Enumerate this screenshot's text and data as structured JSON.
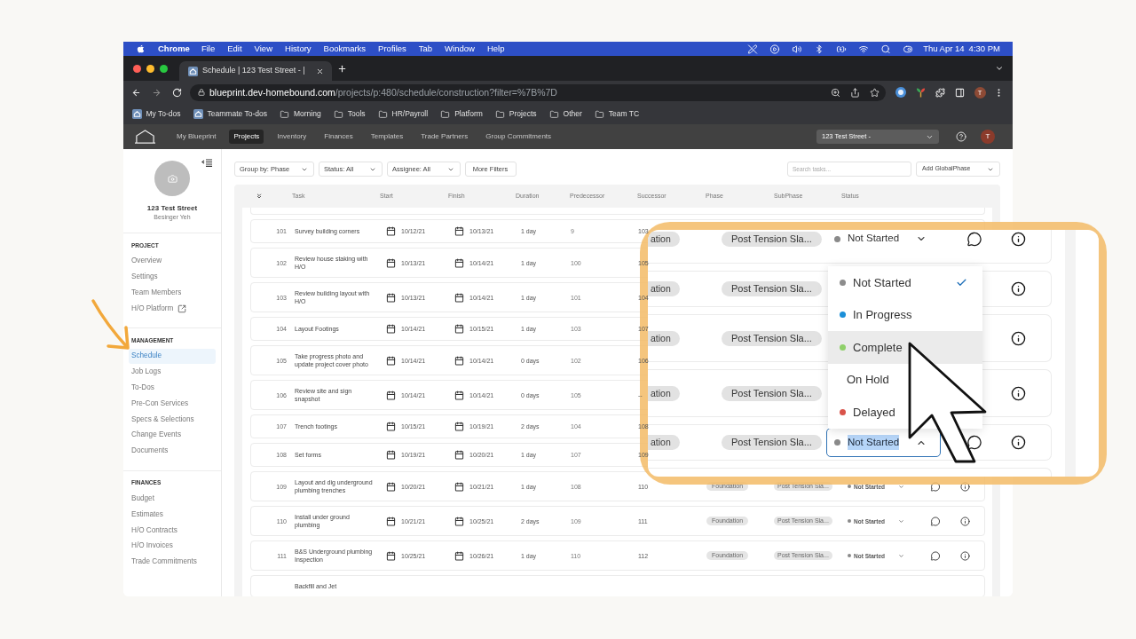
{
  "menu_bar": {
    "app_name": "Chrome",
    "menus": [
      "File",
      "Edit",
      "View",
      "History",
      "Bookmarks",
      "Profiles",
      "Tab",
      "Window",
      "Help"
    ],
    "clock": {
      "date": "Thu Apr 14",
      "time": "4:30 PM"
    }
  },
  "browser": {
    "tab": {
      "title": "Schedule | 123 Test Street - |"
    },
    "address": {
      "host": "blueprint.dev-homebound.com",
      "path": "/projects/p:480/schedule/construction?filter=%7B%7D"
    },
    "profile_initial": "T",
    "bookmarks": [
      {
        "label": "My To-dos",
        "kind": "page"
      },
      {
        "label": "Teammate To-dos",
        "kind": "page"
      },
      {
        "label": "Morning",
        "kind": "folder"
      },
      {
        "label": "Tools",
        "kind": "folder"
      },
      {
        "label": "HR/Payroll",
        "kind": "folder"
      },
      {
        "label": "Platform",
        "kind": "folder"
      },
      {
        "label": "Projects",
        "kind": "folder"
      },
      {
        "label": "Other",
        "kind": "folder"
      },
      {
        "label": "Team TC",
        "kind": "folder"
      }
    ]
  },
  "app_nav": {
    "items": [
      {
        "label": "My Blueprint",
        "selected": false
      },
      {
        "label": "Projects",
        "selected": true
      },
      {
        "label": "Inventory",
        "selected": false
      },
      {
        "label": "Finances",
        "selected": false
      },
      {
        "label": "Templates",
        "selected": false
      },
      {
        "label": "Trade Partners",
        "selected": false
      },
      {
        "label": "Group Commitments",
        "selected": false
      }
    ],
    "project_select": {
      "value": "123 Test Street -"
    },
    "avatar_initial": "T"
  },
  "sidebar": {
    "project": {
      "name": "123 Test Street",
      "owner": "Besinger Yeh"
    },
    "sections": [
      {
        "title": "PROJECT",
        "items": [
          {
            "label": "Overview",
            "kind": "link",
            "selected": false
          },
          {
            "label": "Settings",
            "kind": "link",
            "selected": false
          },
          {
            "label": "Team Members",
            "kind": "link",
            "selected": false
          },
          {
            "label": "H/O Platform",
            "kind": "external",
            "selected": false
          }
        ]
      },
      {
        "title": "MANAGEMENT",
        "items": [
          {
            "label": "Schedule",
            "kind": "link",
            "selected": true
          },
          {
            "label": "Job Logs",
            "kind": "link",
            "selected": false
          },
          {
            "label": "To-Dos",
            "kind": "link",
            "selected": false
          },
          {
            "label": "Pre-Con Services",
            "kind": "link",
            "selected": false
          },
          {
            "label": "Specs & Selections",
            "kind": "link",
            "selected": false
          },
          {
            "label": "Change Events",
            "kind": "link",
            "selected": false
          },
          {
            "label": "Documents",
            "kind": "link",
            "selected": false
          }
        ]
      },
      {
        "title": "FINANCES",
        "items": [
          {
            "label": "Budget",
            "kind": "link",
            "selected": false
          },
          {
            "label": "Estimates",
            "kind": "link",
            "selected": false
          },
          {
            "label": "H/O Contracts",
            "kind": "link",
            "selected": false
          },
          {
            "label": "H/O Invoices",
            "kind": "link",
            "selected": false
          },
          {
            "label": "Trade Commitments",
            "kind": "link",
            "selected": false
          }
        ]
      }
    ]
  },
  "toolbar": {
    "filters": [
      {
        "label": "Group by: Phase",
        "kind": "dropdown"
      },
      {
        "label": "Status: All",
        "kind": "dropdown"
      },
      {
        "label": "Assignee: All",
        "kind": "dropdown"
      },
      {
        "label": "More Filters",
        "kind": "button"
      }
    ],
    "search": {
      "placeholder": "Search tasks..."
    },
    "add_button": {
      "label": "Add GlobalPhase"
    }
  },
  "table": {
    "columns": [
      "Task",
      "Start",
      "Finish",
      "Duration",
      "Predecessor",
      "Successor",
      "Phase",
      "SubPhase",
      "Status"
    ],
    "rows": [
      {
        "number": "101",
        "task": "Survey building corners",
        "start": "10/12/21",
        "finish": "10/13/21",
        "duration": "1 day",
        "predecessor": "9",
        "successor": "103"
      },
      {
        "number": "102",
        "task": "Review house staking with H/O",
        "start": "10/13/21",
        "finish": "10/14/21",
        "duration": "1 day",
        "predecessor": "100",
        "successor": "105"
      },
      {
        "number": "103",
        "task": "Review building layout with H/O",
        "start": "10/13/21",
        "finish": "10/14/21",
        "duration": "1 day",
        "predecessor": "101",
        "successor": "104"
      },
      {
        "number": "104",
        "task": "Layout Footings",
        "start": "10/14/21",
        "finish": "10/15/21",
        "duration": "1 day",
        "predecessor": "103",
        "successor": "107"
      },
      {
        "number": "105",
        "task": "Take progress photo and update project cover photo",
        "start": "10/14/21",
        "finish": "10/14/21",
        "duration": "0 days",
        "predecessor": "102",
        "successor": "106"
      },
      {
        "number": "106",
        "task": "Review site and sign snapshot",
        "start": "10/14/21",
        "finish": "10/14/21",
        "duration": "0 days",
        "predecessor": "105",
        "successor": "--"
      },
      {
        "number": "107",
        "task": "Trench footings",
        "start": "10/15/21",
        "finish": "10/19/21",
        "duration": "2 days",
        "predecessor": "104",
        "successor": "108"
      },
      {
        "number": "108",
        "task": "Set forms",
        "start": "10/19/21",
        "finish": "10/20/21",
        "duration": "1 day",
        "predecessor": "107",
        "successor": "109"
      },
      {
        "number": "109",
        "task": "Layout and dig underground plumbing trenches",
        "start": "10/20/21",
        "finish": "10/21/21",
        "duration": "1 day",
        "predecessor": "108",
        "successor": "110",
        "phase": "Foundation",
        "subphase": "Post Tension Sla...",
        "status": "Not Started"
      },
      {
        "number": "110",
        "task": "Install under ground plumbing",
        "start": "10/21/21",
        "finish": "10/25/21",
        "duration": "2 days",
        "predecessor": "109",
        "successor": "111",
        "phase": "Foundation",
        "subphase": "Post Tension Sla...",
        "status": "Not Started"
      },
      {
        "number": "111",
        "task": "B&S Underground plumbing Inspection",
        "start": "10/25/21",
        "finish": "10/26/21",
        "duration": "1 day",
        "predecessor": "110",
        "successor": "112",
        "phase": "Foundation",
        "subphase": "Post Tension Sla...",
        "status": "Not Started"
      },
      {
        "task": "Backfill and Jet"
      }
    ]
  },
  "zoom_callout": {
    "rows": [
      {
        "phase": "ation",
        "subphase": "Post Tension Sla...",
        "status": {
          "label": "Not Started",
          "open": false
        }
      },
      {
        "phase": "ation",
        "subphase": "Post Tension Sla..."
      },
      {
        "phase": "ation",
        "subphase": "Post Tension Sla..."
      },
      {
        "phase": "ation",
        "subphase": "Post Tension Sla..."
      },
      {
        "phase": "ation",
        "subphase": "Post Tension Sla...",
        "status": {
          "label": "Not Started",
          "open": true
        }
      }
    ],
    "dropdown": {
      "options": [
        {
          "label": "Not Started",
          "color": "#8c8c8c",
          "selected": true,
          "hovered": false
        },
        {
          "label": "In Progress",
          "color": "#1b8fd8",
          "selected": false,
          "hovered": false
        },
        {
          "label": "Complete",
          "color": "#8fd06a",
          "selected": false,
          "hovered": true
        },
        {
          "label": "On Hold",
          "selected": false,
          "hovered": false
        },
        {
          "label": "Delayed",
          "color": "#d9534a",
          "selected": false,
          "hovered": false
        }
      ]
    }
  }
}
